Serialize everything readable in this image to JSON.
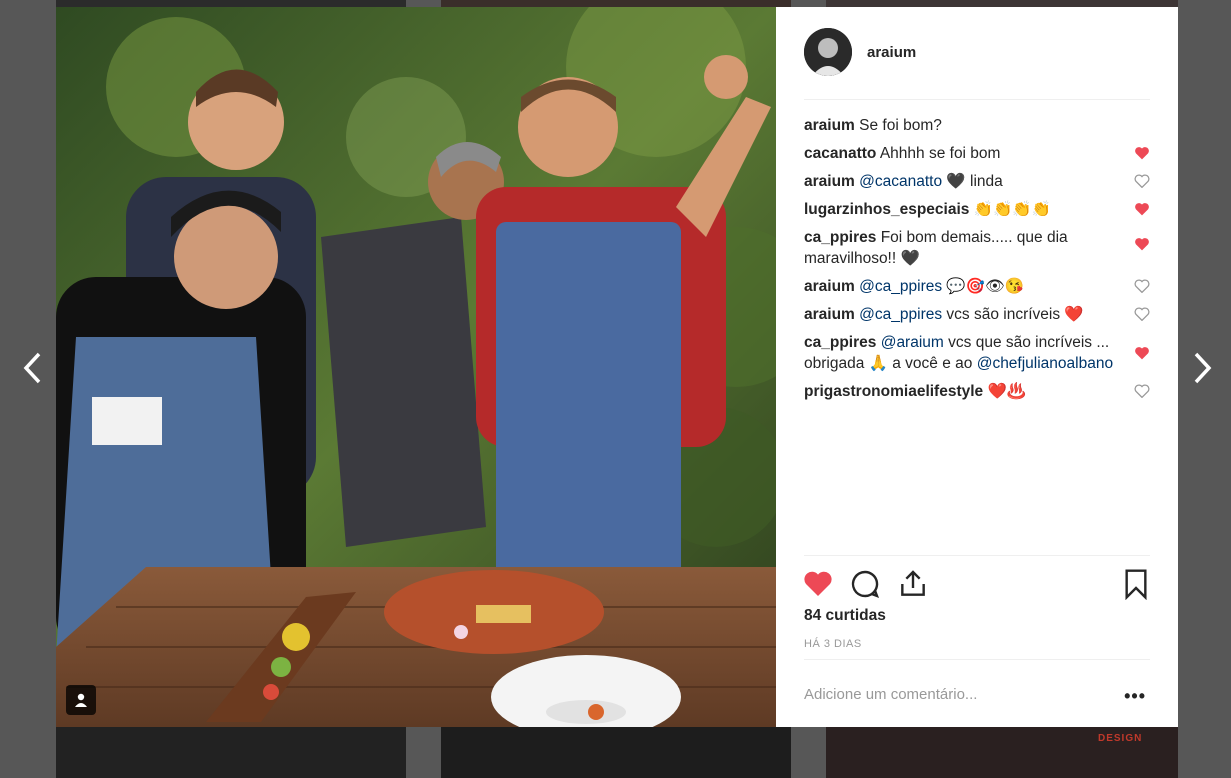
{
  "post": {
    "username": "araium",
    "likes_text": "84 curtidas",
    "time_text": "HÁ 3 DIAS",
    "comment_placeholder": "Adicione um comentário...",
    "more_label": "•••"
  },
  "background": {
    "tag_text": "DESIGN"
  },
  "comments": [
    {
      "user": "araium",
      "mention": "",
      "text": "Se foi bom?",
      "liked": null
    },
    {
      "user": "cacanatto",
      "mention": "",
      "text": "Ahhhh se foi bom",
      "liked": true
    },
    {
      "user": "araium",
      "mention": "@cacanatto",
      "text": "🖤 linda",
      "liked": false
    },
    {
      "user": "lugarzinhos_especiais",
      "mention": "",
      "text": "👏👏👏👏",
      "liked": true
    },
    {
      "user": "ca_ppires",
      "mention": "",
      "text": "Foi bom demais..... que dia maravilhoso!! 🖤",
      "liked": true
    },
    {
      "user": "araium",
      "mention": "@ca_ppires",
      "text": "💬🎯👁😘",
      "liked": false
    },
    {
      "user": "araium",
      "mention": "@ca_ppires",
      "text": "vcs são incríveis ❤️",
      "liked": false
    },
    {
      "user": "ca_ppires",
      "mention": "@araium",
      "text": "vcs que são incríveis ... obrigada 🙏 a você e ao",
      "mention2": "@chefjulianoalbano",
      "liked": true
    },
    {
      "user": "prigastronomiaelifestyle",
      "mention": "",
      "text": "❤️♨️",
      "liked": false
    }
  ],
  "colors": {
    "liked": "#ed4956",
    "text": "#262626",
    "mention": "#003569",
    "muted": "#999999"
  },
  "icons": [
    "chevron-left-icon",
    "chevron-right-icon",
    "heart-icon",
    "comment-icon",
    "share-icon",
    "bookmark-icon",
    "user-tag-icon"
  ]
}
